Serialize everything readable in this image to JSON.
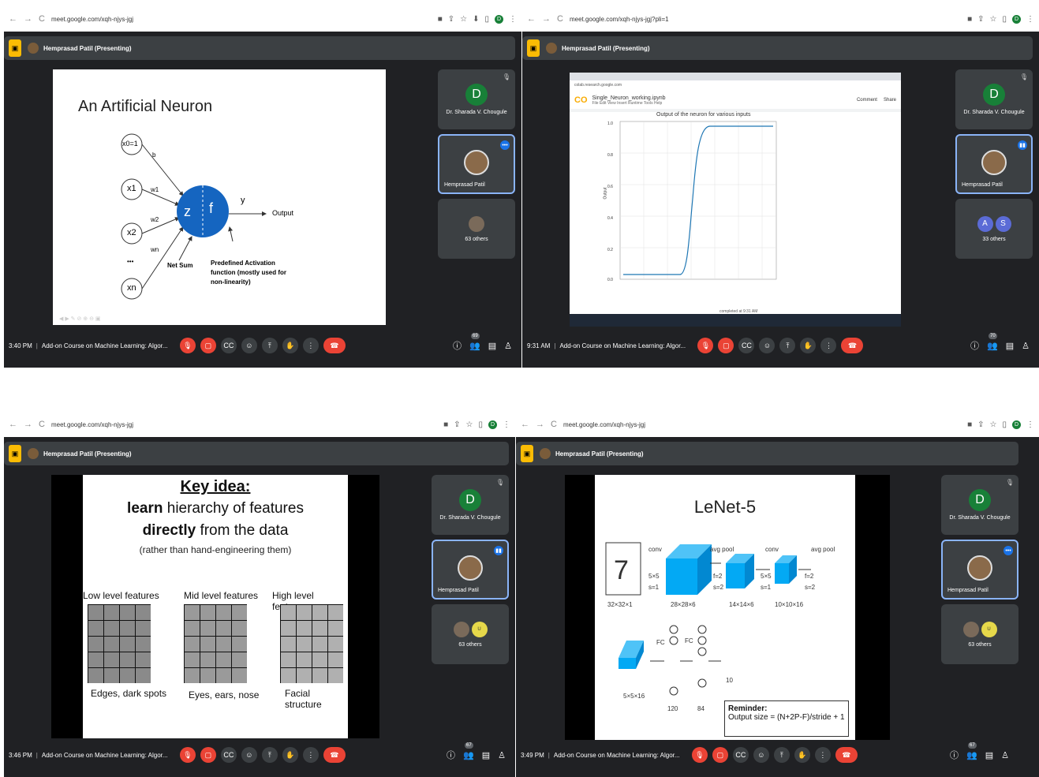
{
  "frames": [
    {
      "url": "meet.google.com/xqh-njys-jgj",
      "presenter": "Hemprasad Patil (Presenting)",
      "time": "3:40 PM",
      "meeting": "Add-on Course on Machine Learning: Algor...",
      "participants_count": "69",
      "tiles": {
        "teacher_initial": "D",
        "teacher_name": "Dr. Sharada V. Chougule",
        "presenter_name": "Hemprasad Patil",
        "others": "63 others"
      },
      "slide": {
        "title": "An Artificial Neuron",
        "inputs": [
          "x0=1",
          "x1",
          "x2",
          "xn"
        ],
        "weights": [
          "b",
          "w1",
          "w2",
          "wn"
        ],
        "ellipsis": "•••",
        "z": "z",
        "f": "f",
        "y": "y",
        "output": "Output",
        "net_sum": "Net Sum",
        "activation": [
          "Predefined Activation",
          "function (mostly used for",
          "non-linearity)"
        ]
      }
    },
    {
      "url": "meet.google.com/xqh-njys-jgj?pli=1",
      "presenter": "Hemprasad Patil (Presenting)",
      "time": "9:31 AM",
      "meeting": "Add-on Course on Machine Learning: Algor...",
      "participants_count": "70",
      "tiles": {
        "teacher_initial": "D",
        "teacher_name": "Dr. Sharada V. Chougule",
        "presenter_name": "Hemprasad Patil",
        "group_initials": [
          "A",
          "S"
        ],
        "others": "33 others"
      },
      "slide": {
        "notebook": "Single_Neuron_working.ipynb",
        "menu": "File  Edit  View  Insert  Runtime  Tools  Help",
        "chart_title": "Output of the neuron for various inputs",
        "ylabel": "Output",
        "status": "completed at 9:31 AM",
        "comment": "Comment",
        "share": "Share"
      }
    },
    {
      "url": "meet.google.com/xqh-njys-jgj",
      "presenter": "Hemprasad Patil (Presenting)",
      "time": "3:46 PM",
      "meeting": "Add-on Course on Machine Learning: Algor...",
      "participants_count": "67",
      "tiles": {
        "teacher_initial": "D",
        "teacher_name": "Dr. Sharada V. Chougule",
        "presenter_name": "Hemprasad Patil",
        "others": "63 others"
      },
      "slide": {
        "key_idea": "Key idea:",
        "line2_bold": "learn",
        "line2_rest": " hierarchy of features",
        "line3_bold": "directly",
        "line3_rest": " from the data",
        "line4": "(rather than hand-engineering them)",
        "low": "Low level features",
        "mid": "Mid level features",
        "high": "High level features",
        "low_cap": "Edges, dark spots",
        "mid_cap": "Eyes, ears, nose",
        "high_cap": "Facial structure"
      }
    },
    {
      "url": "meet.google.com/xqh-njys-jgj",
      "presenter": "Hemprasad Patil (Presenting)",
      "time": "3:49 PM",
      "meeting": "Add-on Course on Machine Learning: Algor...",
      "participants_count": "67",
      "tiles": {
        "teacher_initial": "D",
        "teacher_name": "Dr. Sharada V. Chougule",
        "presenter_name": "Hemprasad Patil",
        "others": "63 others"
      },
      "slide": {
        "title": "LeNet-5",
        "digit": "7",
        "conv": "conv",
        "avgpool": "avg pool",
        "k5": "5×5",
        "s1": "s=1",
        "f2": "f=2",
        "s2": "s=2",
        "dims": [
          "32×32×1",
          "28×28×6",
          "14×14×6",
          "10×10×16",
          "5×5×16"
        ],
        "fc": "FC",
        "fc_sizes": [
          "120",
          "84"
        ],
        "out": "10",
        "reminder": "Reminder:",
        "formula": "Output size = (N+2P-F)/stride + 1"
      }
    }
  ]
}
